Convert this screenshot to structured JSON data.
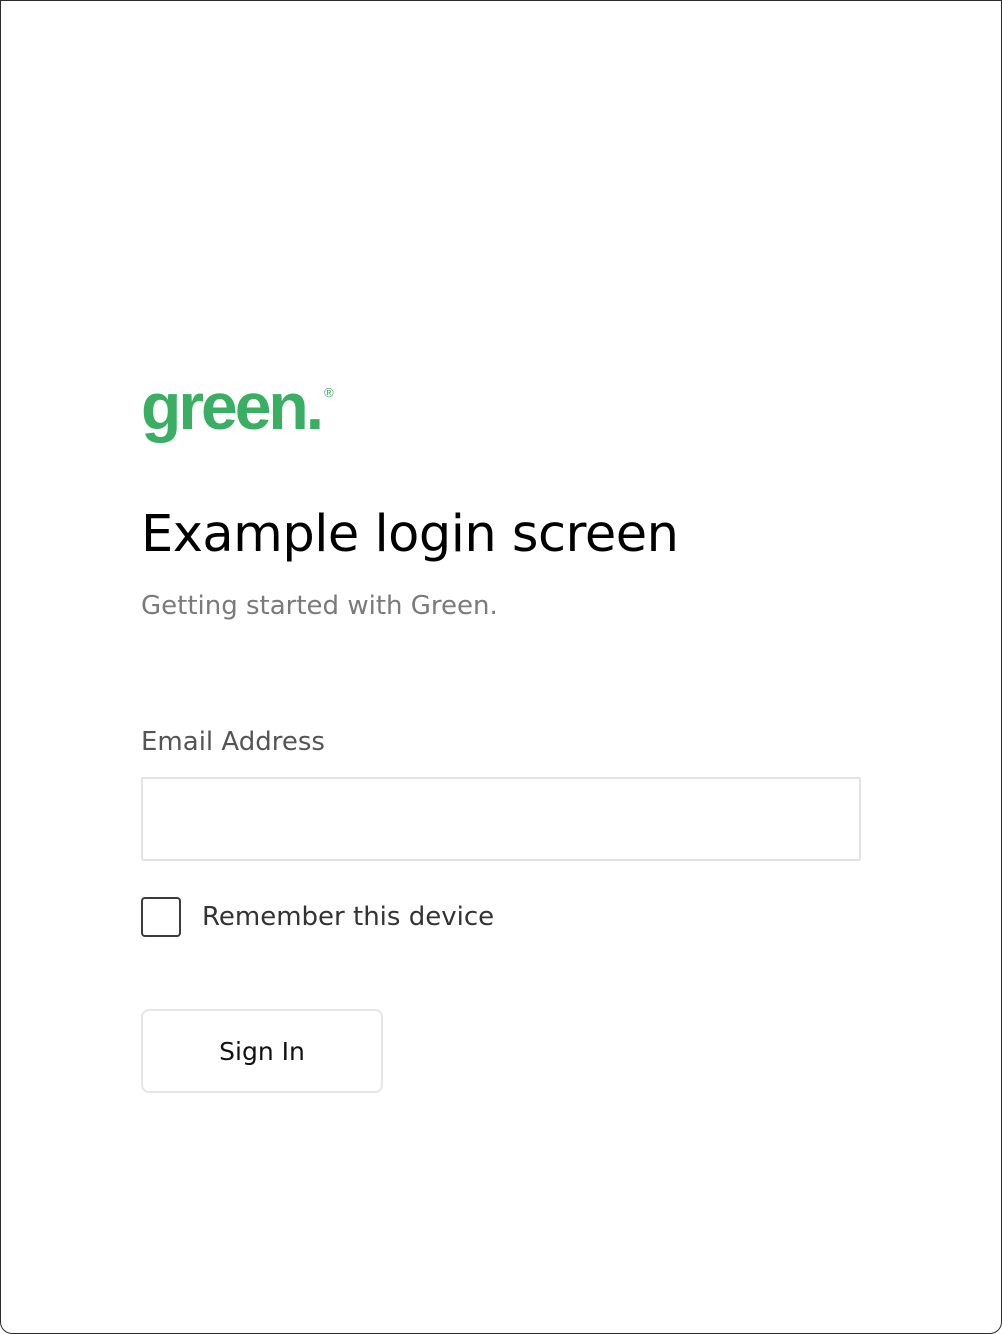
{
  "logo": {
    "wordmark": "green.",
    "registered_mark": "®",
    "color": "#3aaf63"
  },
  "header": {
    "title": "Example login screen",
    "subtitle": "Getting started with Green."
  },
  "form": {
    "email": {
      "label": "Email Address",
      "value": "",
      "placeholder": ""
    },
    "remember": {
      "label": "Remember this device",
      "checked": false
    },
    "submit_label": "Sign In"
  }
}
